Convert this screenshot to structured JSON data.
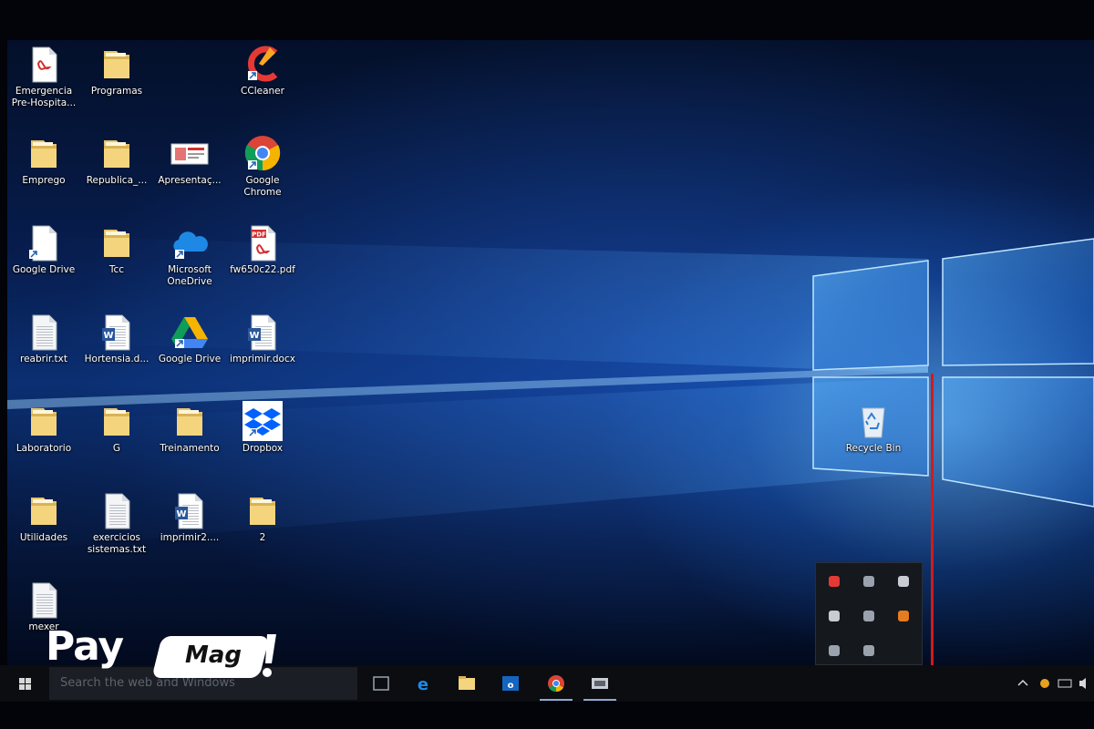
{
  "desktop": {
    "icons": [
      {
        "label": "Emergencia Pre-Hospita...",
        "icon": "pdf-document-icon"
      },
      {
        "label": "Programas",
        "icon": "folder-icon"
      },
      {
        "label": "CCleaner",
        "icon": "ccleaner-icon"
      },
      {
        "label": "Emprego",
        "icon": "folder-icon"
      },
      {
        "label": "Republica_...",
        "icon": "folder-icon"
      },
      {
        "label": "Apresentaç...",
        "icon": "presentation-icon"
      },
      {
        "label": "Google Chrome",
        "icon": "chrome-icon"
      },
      {
        "label": "Google Drive",
        "icon": "blank-document-icon"
      },
      {
        "label": "Tcc",
        "icon": "folder-icon"
      },
      {
        "label": "Microsoft OneDrive",
        "icon": "onedrive-icon"
      },
      {
        "label": "fw650c22.pdf",
        "icon": "pdf-icon"
      },
      {
        "label": "reabrir.txt",
        "icon": "text-file-icon"
      },
      {
        "label": "Hortensia.d...",
        "icon": "word-document-icon"
      },
      {
        "label": "Google Drive",
        "icon": "google-drive-icon"
      },
      {
        "label": "imprimir.docx",
        "icon": "word-document-icon"
      },
      {
        "label": "Laboratorio",
        "icon": "folder-icon"
      },
      {
        "label": "G",
        "icon": "folder-icon"
      },
      {
        "label": "Treinamento",
        "icon": "folder-icon"
      },
      {
        "label": "Dropbox",
        "icon": "dropbox-icon"
      },
      {
        "label": "Utilidades",
        "icon": "folder-icon"
      },
      {
        "label": "exercicios sistemas.txt",
        "icon": "text-file-icon"
      },
      {
        "label": "imprimir2....",
        "icon": "word-document-icon"
      },
      {
        "label": "2",
        "icon": "folder-icon"
      },
      {
        "label": "mexer",
        "icon": "text-file-icon"
      },
      {
        "label": "Recycle Bin",
        "icon": "recycle-bin-icon"
      }
    ]
  },
  "taskbar": {
    "search_placeholder": "Search the web and Windows",
    "apps": [
      "task-view-icon",
      "edge-icon",
      "file-explorer-icon",
      "outlook-icon",
      "chrome-icon",
      "media-app-icon"
    ],
    "tray_icons": [
      "show-hidden-icons-chevron",
      "app-tray-icon",
      "network-icon",
      "volume-icon"
    ]
  },
  "tray_popup": {
    "icons": [
      "red-app-tray-icon",
      "drive-sync-tray-icon",
      "display-tray-icon",
      "camera-tray-icon",
      "signal-tray-icon",
      "ccleaner-tray-icon",
      "bluetooth-tray-icon",
      "onedrive-tray-icon"
    ]
  },
  "brand": {
    "pay": "Pay",
    "mag": "Mag"
  },
  "colors": {
    "accent_red": "#d21a1a",
    "wallpaper_blue": "#0b2f72",
    "taskbar": "#0b0d11"
  }
}
